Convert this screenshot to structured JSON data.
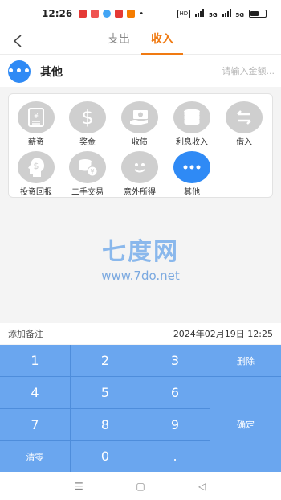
{
  "status_bar": {
    "time": "12:26",
    "notifications": [
      {
        "icon": "red-notification-icon",
        "color": "#e53935"
      },
      {
        "icon": "orange-app-icon",
        "color": "#ef5350"
      },
      {
        "icon": "blue-app-icon",
        "color": "#42a5f5"
      },
      {
        "icon": "red-video-icon",
        "color": "#e53935"
      },
      {
        "icon": "bag-app-icon",
        "color": "#f57c00"
      }
    ],
    "dot": "•",
    "hd_label": "HD",
    "signal_1": "5G",
    "signal_2": "5G",
    "battery_level": 0.55
  },
  "header": {
    "back_symbol": "<",
    "tabs": [
      {
        "label": "支出",
        "active": false
      },
      {
        "label": "收入",
        "active": true
      }
    ]
  },
  "amount": {
    "selected_category": "其他",
    "icon_glyph": "•••",
    "placeholder": "请输入金额..."
  },
  "categories": [
    {
      "label": "薪资",
      "icon": "salary-icon",
      "active": false
    },
    {
      "label": "奖金",
      "icon": "dollar-icon",
      "active": false
    },
    {
      "label": "收债",
      "icon": "debt-collection-icon",
      "active": false
    },
    {
      "label": "利息收入",
      "icon": "coin-stack-icon",
      "active": false
    },
    {
      "label": "借入",
      "icon": "transfer-arrows-icon",
      "active": false
    },
    {
      "label": "投资回报",
      "icon": "investment-head-icon",
      "active": false
    },
    {
      "label": "二手交易",
      "icon": "coins-yen-icon",
      "active": false
    },
    {
      "label": "意外所得",
      "icon": "smiley-icon",
      "active": false
    },
    {
      "label": "其他",
      "icon": "more-dots-icon",
      "active": true
    }
  ],
  "watermark": {
    "title": "七度网",
    "url": "www.7do.net"
  },
  "note": {
    "add_label": "添加备注",
    "datetime": "2024年02月19日 12:25"
  },
  "keypad": {
    "keys": [
      "1",
      "2",
      "3",
      "删除",
      "4",
      "5",
      "6",
      "7",
      "8",
      "9",
      "确定",
      "清零",
      "0",
      "."
    ]
  },
  "nav": {
    "menu": "☰",
    "home": "▢",
    "back": "◁"
  },
  "colors": {
    "accent": "#f07a12",
    "primary_blue": "#2f8af5",
    "keypad_blue": "#6aa6ef",
    "inactive_icon": "#cfcfcf"
  }
}
